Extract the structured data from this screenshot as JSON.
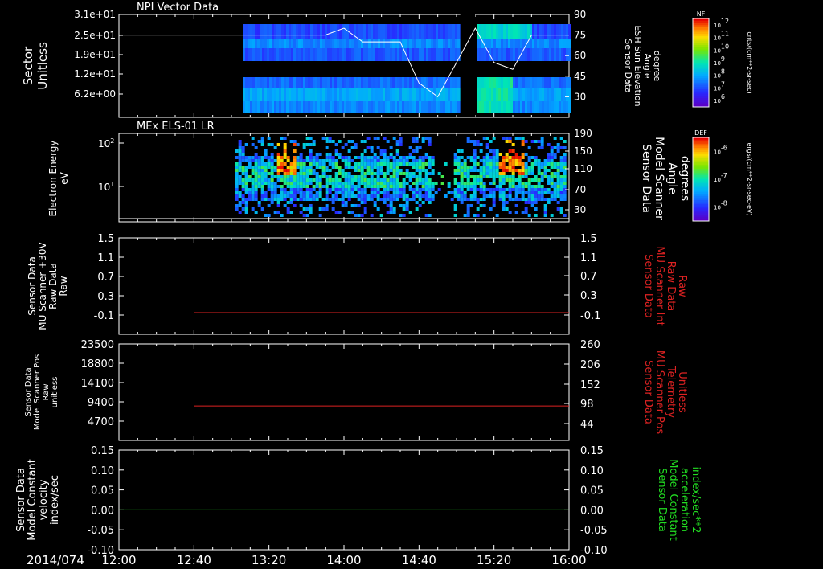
{
  "figure": {
    "date_label": "2014/074",
    "time_ticks": [
      "12:00",
      "12:40",
      "13:20",
      "14:00",
      "14:40",
      "15:20",
      "16:00"
    ],
    "colors": {
      "white": "#ffffff",
      "red": "#dd2222",
      "green": "#22dd22",
      "grid": "#ffffff"
    }
  },
  "chart_data": [
    {
      "type": "heatmap",
      "title": "NPI Vector Data",
      "ylabel": [
        "Sector",
        "Unitless"
      ],
      "y_ticks": [
        "3.1e+01",
        "2.5e+01",
        "1.9e+01",
        "1.2e+01",
        "6.2e+00"
      ],
      "y2label": [
        "Sensor Data",
        "ESH Sun Elevation",
        "Angle",
        "degree"
      ],
      "y2_ticks": [
        "90",
        "75",
        "60",
        "45",
        "30"
      ],
      "y2lim": [
        15,
        90
      ],
      "line_series": {
        "name": "ESH Sun Elevation Angle",
        "x": [
          "12:00",
          "13:06",
          "13:30",
          "13:50",
          "14:00",
          "14:10",
          "14:30",
          "14:40",
          "14:50",
          "15:00",
          "15:10",
          "15:20",
          "15:30",
          "15:40",
          "16:00"
        ],
        "values": [
          75,
          75,
          75,
          75,
          80,
          70,
          70,
          40,
          30,
          55,
          80,
          55,
          50,
          75,
          75
        ]
      },
      "colorbar": {
        "label": "NF",
        "unit": "cnts/(cm**2-sr-sec)",
        "ticks": [
          "10^12",
          "10^11",
          "10^10",
          "10^9",
          "10^8",
          "10^7",
          "10^6"
        ]
      }
    },
    {
      "type": "heatmap",
      "title": "MEx ELS-01 LR",
      "ylabel": [
        "Electron Energy",
        "eV"
      ],
      "y_ticks": [
        "10^2",
        "10^1"
      ],
      "y2label": [
        "Sensor Data",
        "Model Scanner",
        "Angle",
        "degrees"
      ],
      "y2_ticks": [
        "190",
        "150",
        "110",
        "70",
        "30"
      ],
      "colorbar": {
        "label": "DEF",
        "unit": "ergs/(cm**2-sr-sec-eV)",
        "ticks": [
          "10^-6",
          "10^-7",
          "10^-8"
        ]
      }
    },
    {
      "type": "line",
      "ylabel": [
        "Sensor Data",
        "MU Scanner +30V",
        "Raw Data",
        "Raw"
      ],
      "y_ticks": [
        "1.5",
        "1.1",
        "0.7",
        "0.3",
        "-0.1"
      ],
      "ylim": [
        -0.5,
        1.5
      ],
      "y2label": [
        "Sensor Data",
        "MU Scanner Int",
        "Raw Data",
        "Raw"
      ],
      "y2_ticks": [
        "1.5",
        "1.1",
        "0.7",
        "0.3",
        "-0.1"
      ],
      "series": [
        {
          "x_start": "12:40",
          "x_end": "16:00",
          "value": -0.05
        }
      ]
    },
    {
      "type": "line",
      "ylabel": [
        "Sensor Data",
        "Model Scanner Pos",
        "Raw",
        "unitless"
      ],
      "y_ticks": [
        "23500",
        "18800",
        "14100",
        "9400",
        "4700"
      ],
      "ylim": [
        0,
        23500
      ],
      "y2label": [
        "Sensor Data",
        "MU Scanner Pos",
        "Telemetry",
        "Unitless"
      ],
      "y2_ticks": [
        "260",
        "206",
        "152",
        "98",
        "44"
      ],
      "y2lim": [
        0,
        260
      ],
      "series": [
        {
          "x_start": "12:40",
          "x_end": "16:00",
          "value": 8400
        }
      ]
    },
    {
      "type": "line",
      "ylabel": [
        "Sensor Data",
        "Model Constant",
        "velocity",
        "index/sec"
      ],
      "y_ticks": [
        "0.15",
        "0.10",
        "0.05",
        "0.00",
        "-0.05",
        "-0.10"
      ],
      "ylim": [
        -0.1,
        0.15
      ],
      "y2label": [
        "Sensor Data",
        "Model Constant",
        "acceleration",
        "index/sec**2"
      ],
      "y2_ticks": [
        "0.15",
        "0.10",
        "0.05",
        "0.00",
        "-0.05",
        "-0.10"
      ],
      "series": [
        {
          "x_start": "12:00",
          "x_end": "16:00",
          "value": 0.0
        }
      ]
    }
  ]
}
